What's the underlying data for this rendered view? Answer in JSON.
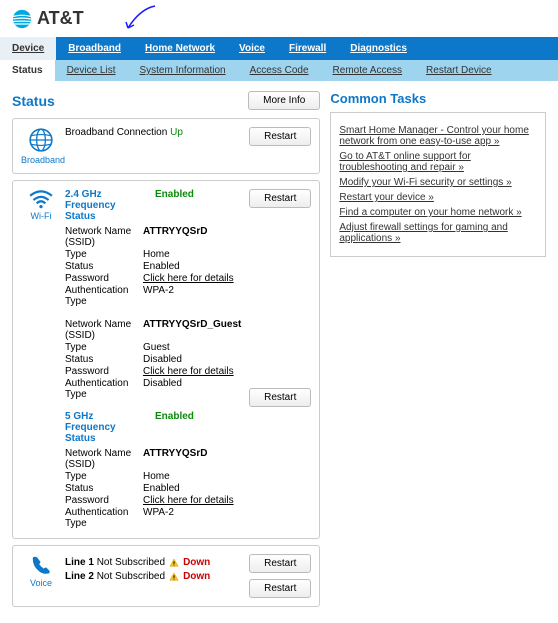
{
  "brand": "AT&T",
  "tabs_primary": [
    "Device",
    "Broadband",
    "Home Network",
    "Voice",
    "Firewall",
    "Diagnostics"
  ],
  "tabs_primary_active": 0,
  "tabs_secondary": [
    "Status",
    "Device List",
    "System Information",
    "Access Code",
    "Remote Access",
    "Restart Device"
  ],
  "tabs_secondary_active": 0,
  "status_title": "Status",
  "btn_more_info": "More Info",
  "btn_restart": "Restart",
  "broadband": {
    "icon_label": "Broadband",
    "label": "Broadband Connection",
    "state": "Up"
  },
  "wifi": {
    "icon_label": "Wi-Fi",
    "bands": [
      {
        "title": "2.4 GHz Frequency Status",
        "state": "Enabled",
        "networks": [
          {
            "ssid": "ATTRYYQSrD",
            "type": "Home",
            "status": "Enabled",
            "password": "Click here for details",
            "auth": "WPA-2"
          },
          {
            "ssid": "ATTRYYQSrD_Guest",
            "type": "Guest",
            "status": "Disabled",
            "password": "Click here for details",
            "auth": "Disabled"
          }
        ]
      },
      {
        "title": "5 GHz Frequency Status",
        "state": "Enabled",
        "networks": [
          {
            "ssid": "ATTRYYQSrD",
            "type": "Home",
            "status": "Enabled",
            "password": "Click here for details",
            "auth": "WPA-2"
          }
        ]
      }
    ],
    "kv_labels": {
      "ssid": "Network Name (SSID)",
      "type": "Type",
      "status": "Status",
      "password": "Password",
      "auth": "Authentication Type"
    }
  },
  "voice": {
    "icon_label": "Voice",
    "lines": [
      {
        "name": "Line 1",
        "sub": "Not Subscribed",
        "state": "Down"
      },
      {
        "name": "Line 2",
        "sub": "Not Subscribed",
        "state": "Down"
      }
    ]
  },
  "common": {
    "title": "Common Tasks",
    "links": [
      "Smart Home Manager - Control your home network from one easy-to-use app »",
      "Go to AT&T online support for troubleshooting and repair »",
      "Modify your Wi-Fi security or settings »",
      "Restart your device »",
      "Find a computer on your home network »",
      "Adjust firewall settings for gaming and applications »"
    ]
  }
}
